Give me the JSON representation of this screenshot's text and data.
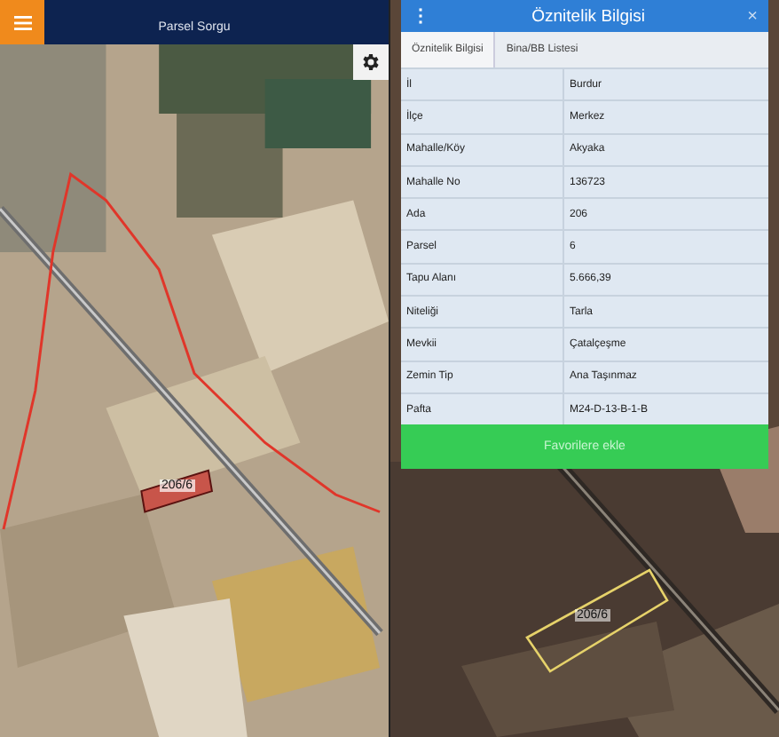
{
  "left_screen": {
    "header": {
      "title": "Parsel Sorgu"
    },
    "map": {
      "parcel_label": "206/6"
    }
  },
  "right_screen": {
    "dialog": {
      "menu_glyph": "⋮",
      "title": "Öznitelik Bilgisi",
      "close_glyph": "×",
      "tabs": [
        {
          "label": "Öznitelik Bilgisi",
          "selected": true
        },
        {
          "label": "Bina/BB Listesi",
          "selected": false
        }
      ],
      "rows": [
        {
          "label": "İl",
          "value": "Burdur"
        },
        {
          "label": "İlçe",
          "value": "Merkez"
        },
        {
          "label": "Mahalle/Köy",
          "value": "Akyaka"
        },
        {
          "label": "Mahalle No",
          "value": "136723"
        },
        {
          "label": "Ada",
          "value": "206"
        },
        {
          "label": "Parsel",
          "value": "6"
        },
        {
          "label": "Tapu Alanı",
          "value": "5.666,39"
        },
        {
          "label": "Niteliği",
          "value": "Tarla"
        },
        {
          "label": "Mevkii",
          "value": "Çatalçeşme"
        },
        {
          "label": "Zemin Tip",
          "value": "Ana Taşınmaz"
        },
        {
          "label": "Pafta",
          "value": "M24-D-13-B-1-B"
        }
      ],
      "button": "Favorilere ekle"
    },
    "map": {
      "parcel_label": "206/6"
    }
  }
}
